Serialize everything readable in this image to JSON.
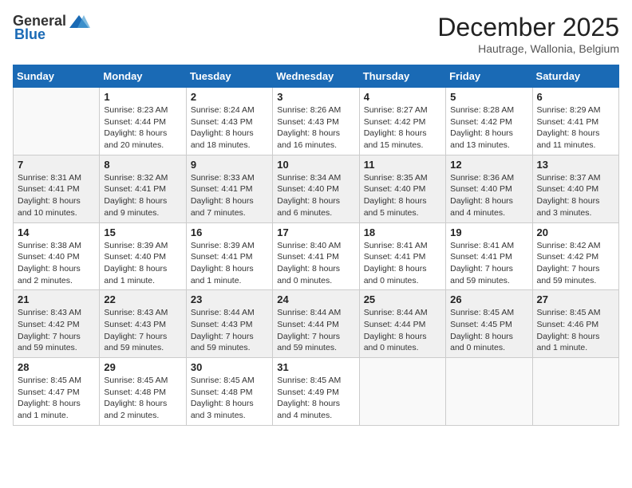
{
  "header": {
    "logo_general": "General",
    "logo_blue": "Blue",
    "title": "December 2025",
    "subtitle": "Hautrage, Wallonia, Belgium"
  },
  "calendar": {
    "weekdays": [
      "Sunday",
      "Monday",
      "Tuesday",
      "Wednesday",
      "Thursday",
      "Friday",
      "Saturday"
    ],
    "weeks": [
      [
        {
          "day": "",
          "info": ""
        },
        {
          "day": "1",
          "info": "Sunrise: 8:23 AM\nSunset: 4:44 PM\nDaylight: 8 hours\nand 20 minutes."
        },
        {
          "day": "2",
          "info": "Sunrise: 8:24 AM\nSunset: 4:43 PM\nDaylight: 8 hours\nand 18 minutes."
        },
        {
          "day": "3",
          "info": "Sunrise: 8:26 AM\nSunset: 4:43 PM\nDaylight: 8 hours\nand 16 minutes."
        },
        {
          "day": "4",
          "info": "Sunrise: 8:27 AM\nSunset: 4:42 PM\nDaylight: 8 hours\nand 15 minutes."
        },
        {
          "day": "5",
          "info": "Sunrise: 8:28 AM\nSunset: 4:42 PM\nDaylight: 8 hours\nand 13 minutes."
        },
        {
          "day": "6",
          "info": "Sunrise: 8:29 AM\nSunset: 4:41 PM\nDaylight: 8 hours\nand 11 minutes."
        }
      ],
      [
        {
          "day": "7",
          "info": "Sunrise: 8:31 AM\nSunset: 4:41 PM\nDaylight: 8 hours\nand 10 minutes."
        },
        {
          "day": "8",
          "info": "Sunrise: 8:32 AM\nSunset: 4:41 PM\nDaylight: 8 hours\nand 9 minutes."
        },
        {
          "day": "9",
          "info": "Sunrise: 8:33 AM\nSunset: 4:41 PM\nDaylight: 8 hours\nand 7 minutes."
        },
        {
          "day": "10",
          "info": "Sunrise: 8:34 AM\nSunset: 4:40 PM\nDaylight: 8 hours\nand 6 minutes."
        },
        {
          "day": "11",
          "info": "Sunrise: 8:35 AM\nSunset: 4:40 PM\nDaylight: 8 hours\nand 5 minutes."
        },
        {
          "day": "12",
          "info": "Sunrise: 8:36 AM\nSunset: 4:40 PM\nDaylight: 8 hours\nand 4 minutes."
        },
        {
          "day": "13",
          "info": "Sunrise: 8:37 AM\nSunset: 4:40 PM\nDaylight: 8 hours\nand 3 minutes."
        }
      ],
      [
        {
          "day": "14",
          "info": "Sunrise: 8:38 AM\nSunset: 4:40 PM\nDaylight: 8 hours\nand 2 minutes."
        },
        {
          "day": "15",
          "info": "Sunrise: 8:39 AM\nSunset: 4:40 PM\nDaylight: 8 hours\nand 1 minute."
        },
        {
          "day": "16",
          "info": "Sunrise: 8:39 AM\nSunset: 4:41 PM\nDaylight: 8 hours\nand 1 minute."
        },
        {
          "day": "17",
          "info": "Sunrise: 8:40 AM\nSunset: 4:41 PM\nDaylight: 8 hours\nand 0 minutes."
        },
        {
          "day": "18",
          "info": "Sunrise: 8:41 AM\nSunset: 4:41 PM\nDaylight: 8 hours\nand 0 minutes."
        },
        {
          "day": "19",
          "info": "Sunrise: 8:41 AM\nSunset: 4:41 PM\nDaylight: 7 hours\nand 59 minutes."
        },
        {
          "day": "20",
          "info": "Sunrise: 8:42 AM\nSunset: 4:42 PM\nDaylight: 7 hours\nand 59 minutes."
        }
      ],
      [
        {
          "day": "21",
          "info": "Sunrise: 8:43 AM\nSunset: 4:42 PM\nDaylight: 7 hours\nand 59 minutes."
        },
        {
          "day": "22",
          "info": "Sunrise: 8:43 AM\nSunset: 4:43 PM\nDaylight: 7 hours\nand 59 minutes."
        },
        {
          "day": "23",
          "info": "Sunrise: 8:44 AM\nSunset: 4:43 PM\nDaylight: 7 hours\nand 59 minutes."
        },
        {
          "day": "24",
          "info": "Sunrise: 8:44 AM\nSunset: 4:44 PM\nDaylight: 7 hours\nand 59 minutes."
        },
        {
          "day": "25",
          "info": "Sunrise: 8:44 AM\nSunset: 4:44 PM\nDaylight: 8 hours\nand 0 minutes."
        },
        {
          "day": "26",
          "info": "Sunrise: 8:45 AM\nSunset: 4:45 PM\nDaylight: 8 hours\nand 0 minutes."
        },
        {
          "day": "27",
          "info": "Sunrise: 8:45 AM\nSunset: 4:46 PM\nDaylight: 8 hours\nand 1 minute."
        }
      ],
      [
        {
          "day": "28",
          "info": "Sunrise: 8:45 AM\nSunset: 4:47 PM\nDaylight: 8 hours\nand 1 minute."
        },
        {
          "day": "29",
          "info": "Sunrise: 8:45 AM\nSunset: 4:48 PM\nDaylight: 8 hours\nand 2 minutes."
        },
        {
          "day": "30",
          "info": "Sunrise: 8:45 AM\nSunset: 4:48 PM\nDaylight: 8 hours\nand 3 minutes."
        },
        {
          "day": "31",
          "info": "Sunrise: 8:45 AM\nSunset: 4:49 PM\nDaylight: 8 hours\nand 4 minutes."
        },
        {
          "day": "",
          "info": ""
        },
        {
          "day": "",
          "info": ""
        },
        {
          "day": "",
          "info": ""
        }
      ]
    ]
  }
}
